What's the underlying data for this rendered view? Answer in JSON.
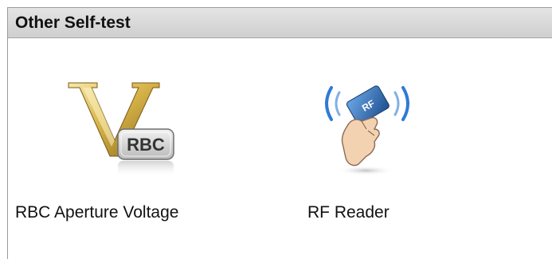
{
  "panel": {
    "title": "Other Self-test"
  },
  "items": [
    {
      "label": "RBC Aperture Voltage",
      "icon_text": "RBC",
      "icon": "rbc-voltage-icon"
    },
    {
      "label": "RF Reader",
      "icon_text": "RF",
      "icon": "rf-reader-icon"
    }
  ],
  "colors": {
    "header_bg": "#d6d6d6",
    "gold": "#c9a43a",
    "rf_card": "#2f6fb5",
    "rf_waves": "#2f7ad6"
  }
}
